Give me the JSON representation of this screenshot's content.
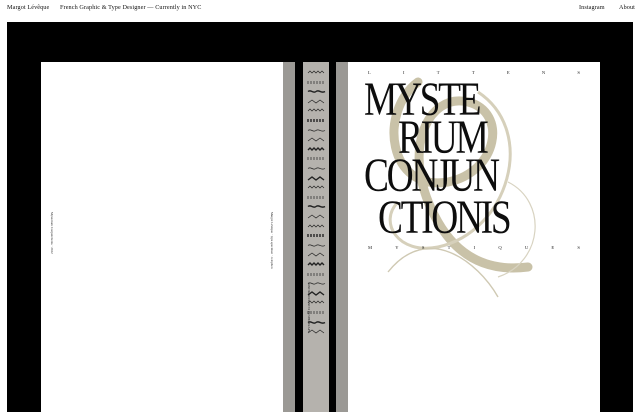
{
  "header": {
    "name": "Margot Lévêque",
    "tagline": "French Graphic & Type Designer — Currently in NYC",
    "nav": [
      "Instagram",
      "About"
    ]
  },
  "book": {
    "left_page_text_a": "Mysterium Conjunctionis · 2022",
    "left_page_text_b": "Margot Lévêque · type specimen · colophon",
    "spine_text": "MYSTERIUM CONJUNCTIONIS",
    "top_letters": [
      "L",
      "I",
      "T",
      "T",
      "E",
      "N",
      "S"
    ],
    "title_lines": [
      "MYSTE",
      "RIUM",
      "CONJUN",
      "CTIONIS"
    ],
    "bottom_letters": [
      "M",
      "Y",
      "S",
      "T",
      "I",
      "Q",
      "U",
      "E",
      "S"
    ]
  },
  "colors": {
    "stage": "#000000",
    "ornament": "#c9c2a8",
    "page": "#ffffff",
    "strip": "#9b9995"
  }
}
